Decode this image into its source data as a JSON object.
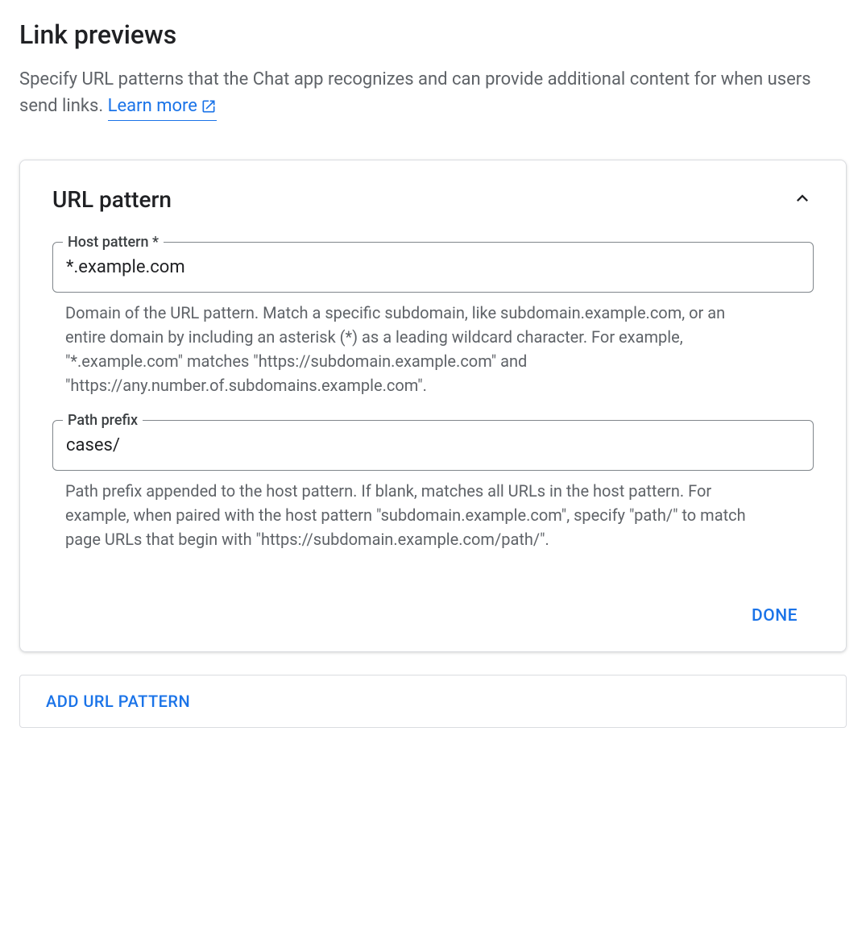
{
  "section": {
    "title": "Link previews",
    "description": "Specify URL patterns that the Chat app recognizes and can provide additional content for when users send links. ",
    "learn_more_label": "Learn more"
  },
  "card": {
    "title": "URL pattern",
    "host_pattern": {
      "label": "Host pattern *",
      "value": "*.example.com",
      "help": "Domain of the URL pattern. Match a specific subdomain, like subdomain.example.com, or an entire domain by including an asterisk (*) as a leading wildcard character. For example, \"*.example.com\" matches \"https://subdomain.example.com\" and \"https://any.number.of.subdomains.example.com\"."
    },
    "path_prefix": {
      "label": "Path prefix",
      "value": "cases/",
      "help": "Path prefix appended to the host pattern. If blank, matches all URLs in the host pattern. For example, when paired with the host pattern \"subdomain.example.com\", specify \"path/\" to match page URLs that begin with \"https://subdomain.example.com/path/\"."
    },
    "done_label": "DONE"
  },
  "add_button_label": "ADD URL PATTERN"
}
